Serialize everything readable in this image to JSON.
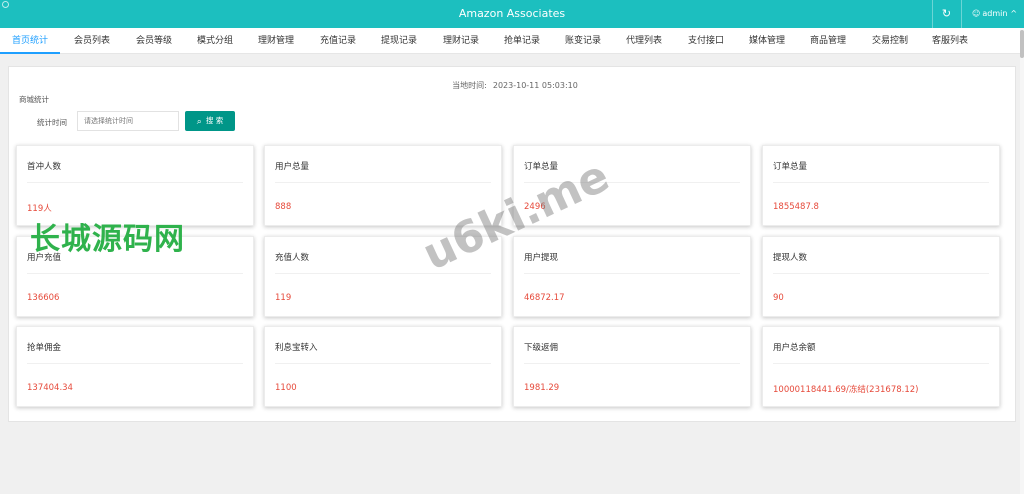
{
  "header": {
    "title": "Amazon Associates",
    "refresh_icon": "refresh-icon",
    "user": "admin",
    "user_icon": "user-icon",
    "chevron": "^"
  },
  "tabs": [
    {
      "label": "首页统计",
      "active": true
    },
    {
      "label": "会员列表"
    },
    {
      "label": "会员等级"
    },
    {
      "label": "模式分组"
    },
    {
      "label": "理财管理"
    },
    {
      "label": "充值记录"
    },
    {
      "label": "提现记录"
    },
    {
      "label": "理财记录"
    },
    {
      "label": "抢单记录"
    },
    {
      "label": "账变记录"
    },
    {
      "label": "代理列表"
    },
    {
      "label": "支付接口"
    },
    {
      "label": "媒体管理"
    },
    {
      "label": "商品管理"
    },
    {
      "label": "交易控制"
    },
    {
      "label": "客服列表"
    }
  ],
  "main": {
    "local_time_label": "当地时间:",
    "local_time_value": "2023-10-11 05:03:10",
    "section_label": "商城统计",
    "filter_label": "统计时间",
    "filter_placeholder": "请选择统计时间",
    "search_label": "搜 索",
    "search_icon": "search-icon"
  },
  "cards": [
    {
      "label": "首冲人数",
      "value": "119人"
    },
    {
      "label": "用户总量",
      "value": "888"
    },
    {
      "label": "订单总量",
      "value": "2496"
    },
    {
      "label": "订单总量",
      "value": "1855487.8"
    },
    {
      "label": "用户充值",
      "value": "136606"
    },
    {
      "label": "充值人数",
      "value": "119"
    },
    {
      "label": "用户提现",
      "value": "46872.17"
    },
    {
      "label": "提现人数",
      "value": "90"
    },
    {
      "label": "抢单佣金",
      "value": "137404.34"
    },
    {
      "label": "利息宝转入",
      "value": "1100"
    },
    {
      "label": "下级返佣",
      "value": "1981.29"
    },
    {
      "label": "用户总余额",
      "value": "10000118441.69/冻结(231678.12)"
    }
  ],
  "watermarks": {
    "primary": "长城源码网",
    "secondary": "u6ki.me"
  },
  "colors": {
    "header_bg": "#1cbfbf",
    "active_tab": "#1e9fff",
    "search_btn": "#009688",
    "value_text": "#e64a3b",
    "watermark_green": "#2fb24c"
  }
}
